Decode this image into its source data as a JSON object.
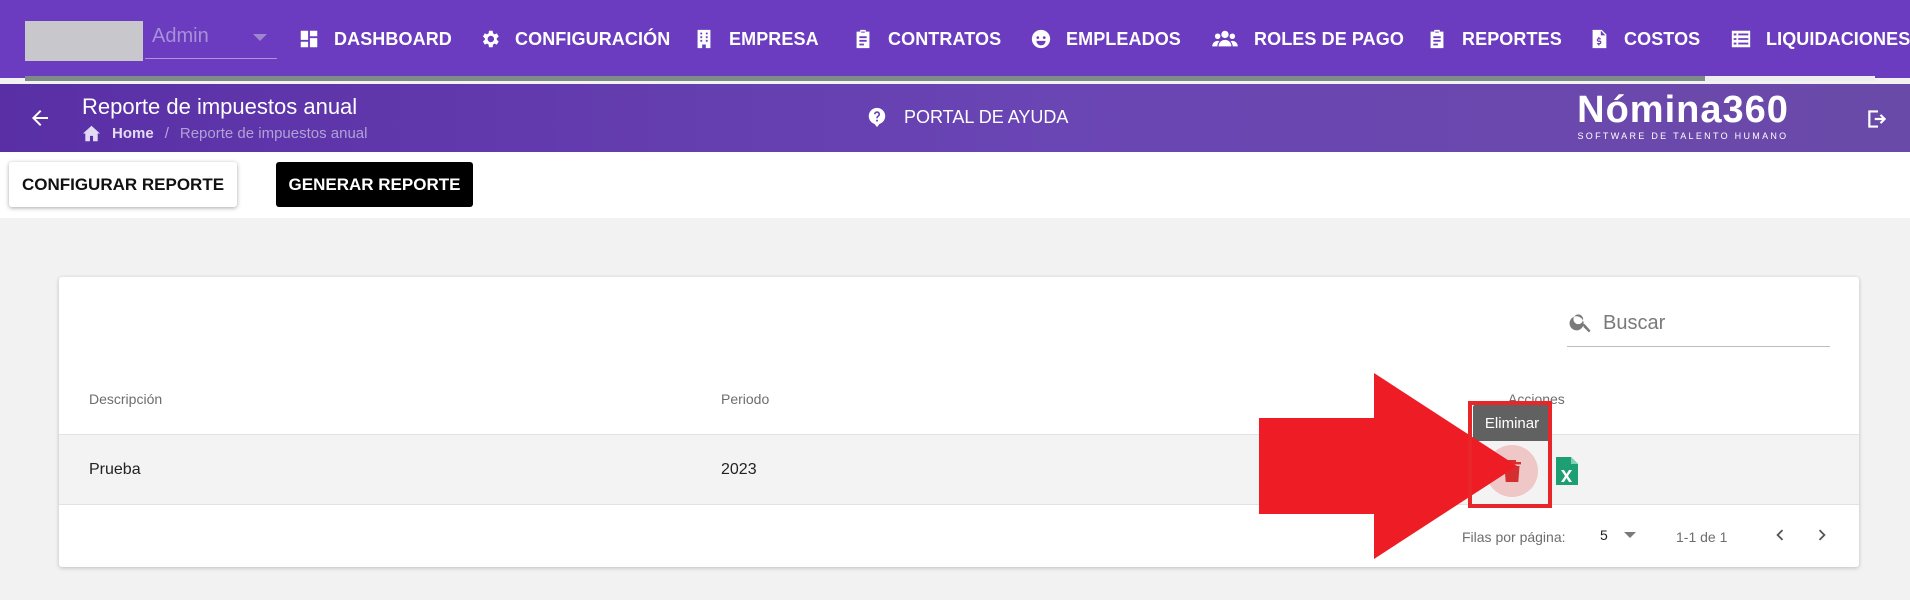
{
  "user": {
    "name": "Admin"
  },
  "nav": {
    "items": [
      {
        "label": "DASHBOARD",
        "icon": "dashboard-icon"
      },
      {
        "label": "CONFIGURACIÓN",
        "icon": "gear-icon"
      },
      {
        "label": "EMPRESA",
        "icon": "building-icon"
      },
      {
        "label": "CONTRATOS",
        "icon": "clipboard-icon"
      },
      {
        "label": "EMPLEADOS",
        "icon": "face-icon"
      },
      {
        "label": "ROLES DE PAGO",
        "icon": "users-icon"
      },
      {
        "label": "REPORTES",
        "icon": "clipboard-list-icon"
      },
      {
        "label": "COSTOS",
        "icon": "invoice-dollar-icon"
      },
      {
        "label": "LIQUIDACIONES",
        "icon": "list-icon"
      }
    ],
    "active": "LIQUIDACIONES"
  },
  "header": {
    "title": "Reporte de impuestos anual",
    "breadcrumb": {
      "home": "Home",
      "separator": "/",
      "current": "Reporte de impuestos anual"
    },
    "help_label": "PORTAL DE AYUDA",
    "brand_name": "Nómina360",
    "brand_tagline": "SOFTWARE DE TALENTO HUMANO"
  },
  "toolbar": {
    "configure_label": "CONFIGURAR REPORTE",
    "generate_label": "GENERAR REPORTE"
  },
  "search": {
    "placeholder": "Buscar"
  },
  "table": {
    "columns": [
      "Descripción",
      "Periodo",
      "Acciones"
    ],
    "rows": [
      {
        "descripcion": "Prueba",
        "periodo": "2023"
      }
    ],
    "delete_tooltip": "Eliminar",
    "footer": {
      "rows_per_page_label": "Filas por página:",
      "rows_per_page": "5",
      "range": "1-1 de 1"
    }
  },
  "colors": {
    "nav_bg": "#6b3cbf",
    "header_bg": "#5a2fa6",
    "delete_icon": "#d32f2f",
    "excel_icon": "#1e9e73",
    "annotation": "#e8262a"
  }
}
